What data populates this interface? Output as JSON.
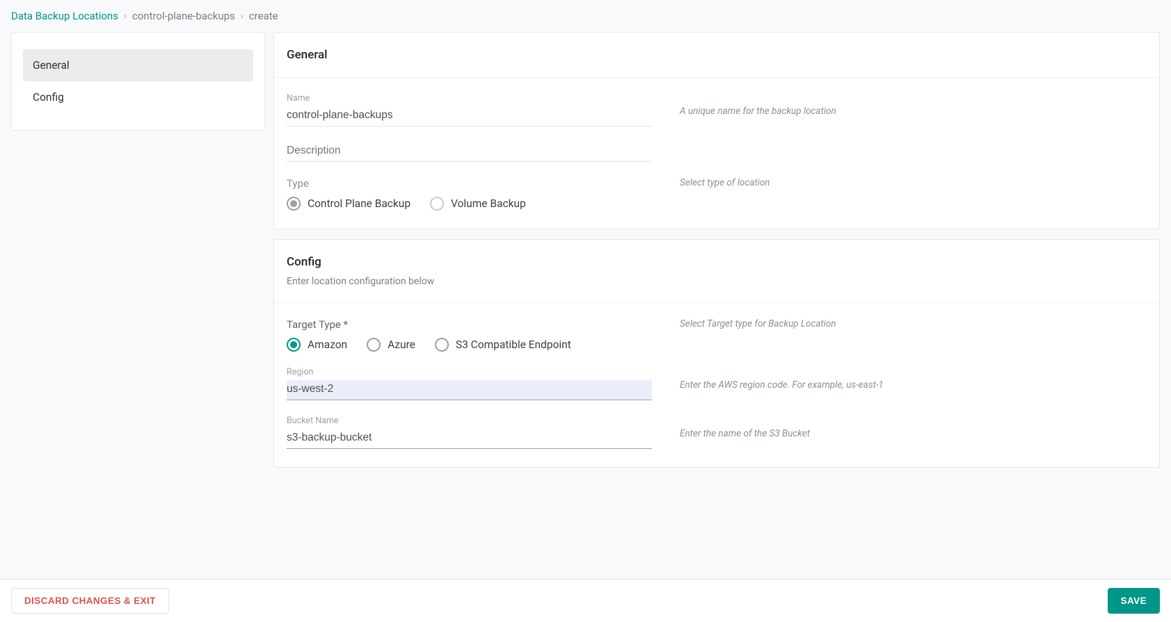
{
  "breadcrumb": {
    "root": "Data Backup Locations",
    "mid": "control-plane-backups",
    "leaf": "create"
  },
  "sidenav": {
    "items": [
      {
        "label": "General",
        "active": true
      },
      {
        "label": "Config",
        "active": false
      }
    ]
  },
  "general": {
    "title": "General",
    "name_label": "Name",
    "name_value": "control-plane-backups",
    "name_hint": "A unique name for the backup location",
    "description_label": "Description",
    "description_value": "",
    "type_label": "Type",
    "type_hint": "Select type of location",
    "type_options": {
      "cp": "Control Plane Backup",
      "vol": "Volume Backup"
    }
  },
  "config": {
    "title": "Config",
    "subtitle": "Enter location configuration below",
    "target_label": "Target Type *",
    "target_hint": "Select Target type for Backup Location",
    "target_options": {
      "amazon": "Amazon",
      "azure": "Azure",
      "s3": "S3 Compatible Endpoint"
    },
    "region_label": "Region",
    "region_value": "us-west-2",
    "region_hint": "Enter the AWS region code. For example, us-east-1",
    "bucket_label": "Bucket Name",
    "bucket_value": "s3-backup-bucket",
    "bucket_hint": "Enter the name of the S3 Bucket"
  },
  "footer": {
    "discard": "Discard Changes & Exit",
    "save": "Save"
  }
}
